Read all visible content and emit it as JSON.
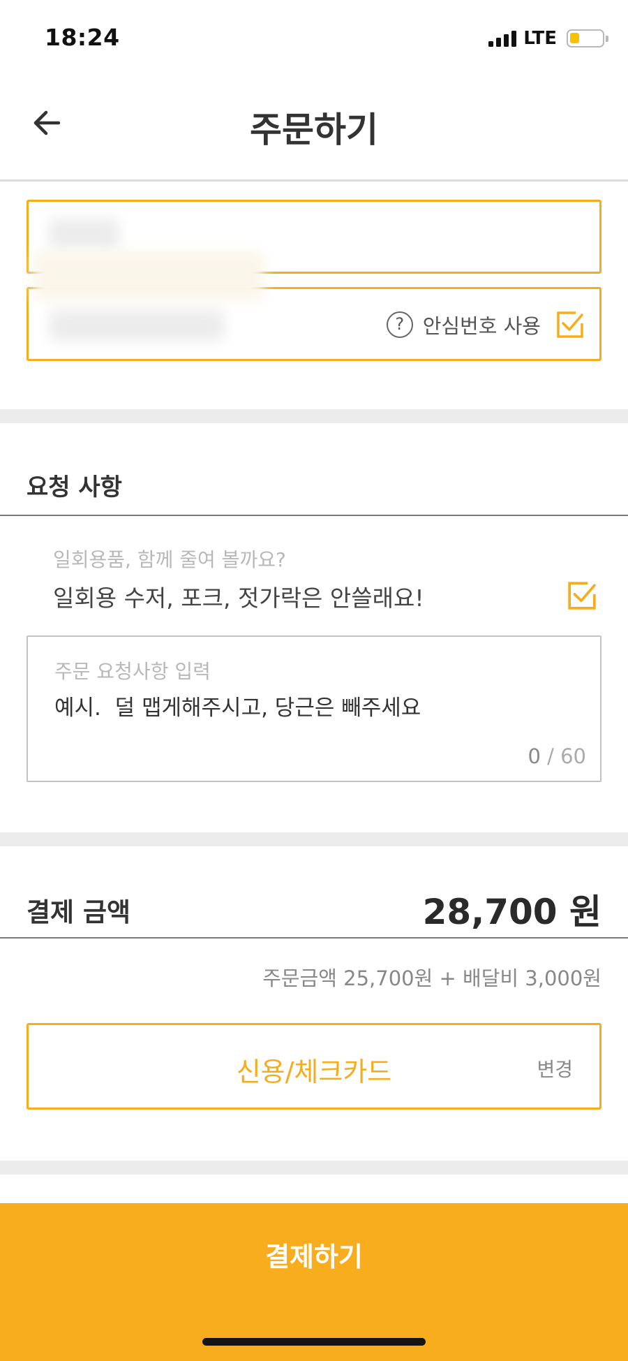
{
  "status_bar": {
    "time": "18:24",
    "network": "LTE",
    "battery_level": 0.3,
    "battery_color": "#f5c300"
  },
  "header": {
    "title": "주문하기",
    "back_icon": "arrow-left-icon"
  },
  "contact": {
    "phone_option_label": "안심번호 사용",
    "phone_option_checked": true
  },
  "request": {
    "section_title": "요청 사항",
    "disposable_question": "일회용품, 함께 줄여 볼까요?",
    "disposable_answer": "일회용 수저, 포크, 젓가락은 안쓸래요!",
    "disposable_checked": true,
    "input_placeholder": "주문 요청사항 입력",
    "input_example": "예시.  덜 맵게해주시고, 당근은 빼주세요",
    "char_count": "0",
    "char_limit": "/ 60"
  },
  "payment": {
    "section_title": "결제 금액",
    "total": "28,700 원",
    "breakdown": "주문금액 25,700원 + 배달비 3,000원",
    "method": "신용/체크카드",
    "change_label": "변경"
  },
  "submit": {
    "label": "결제하기"
  },
  "colors": {
    "accent": "#f5ad1e",
    "button": "#f7ad1e",
    "section_gap": "#ececec"
  }
}
